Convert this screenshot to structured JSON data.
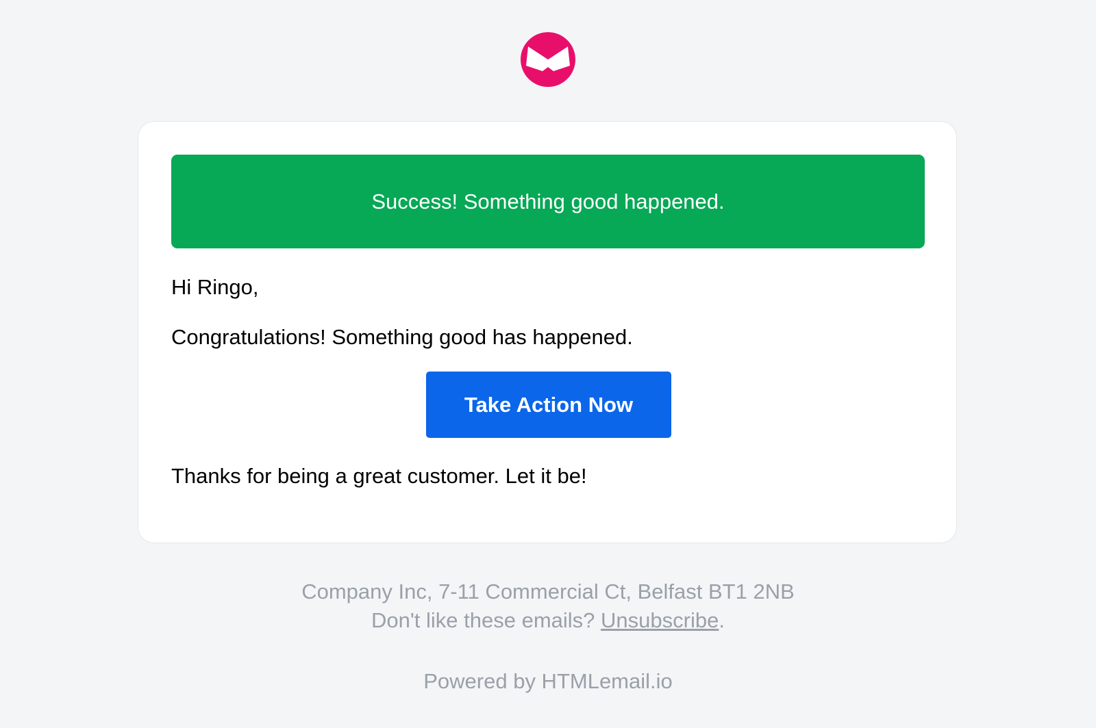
{
  "logo": {
    "icon": "envelope-bowtie-icon",
    "color": "#e80f6a"
  },
  "alert": {
    "text": "Success! Something good happened.",
    "color": "#07a856"
  },
  "email": {
    "greeting": "Hi Ringo,",
    "message": "Congratulations! Something good has happened.",
    "cta_label": "Take Action Now",
    "cta_color": "#0b66ea",
    "closing": "Thanks for being a great customer. Let it be!"
  },
  "footer": {
    "address": "Company Inc, 7-11 Commercial Ct, Belfast BT1 2NB",
    "unsubscribe_prefix": "Don't like these emails? ",
    "unsubscribe_link": "Unsubscribe",
    "unsubscribe_suffix": ".",
    "powered_by": "Powered by HTMLemail.io"
  }
}
